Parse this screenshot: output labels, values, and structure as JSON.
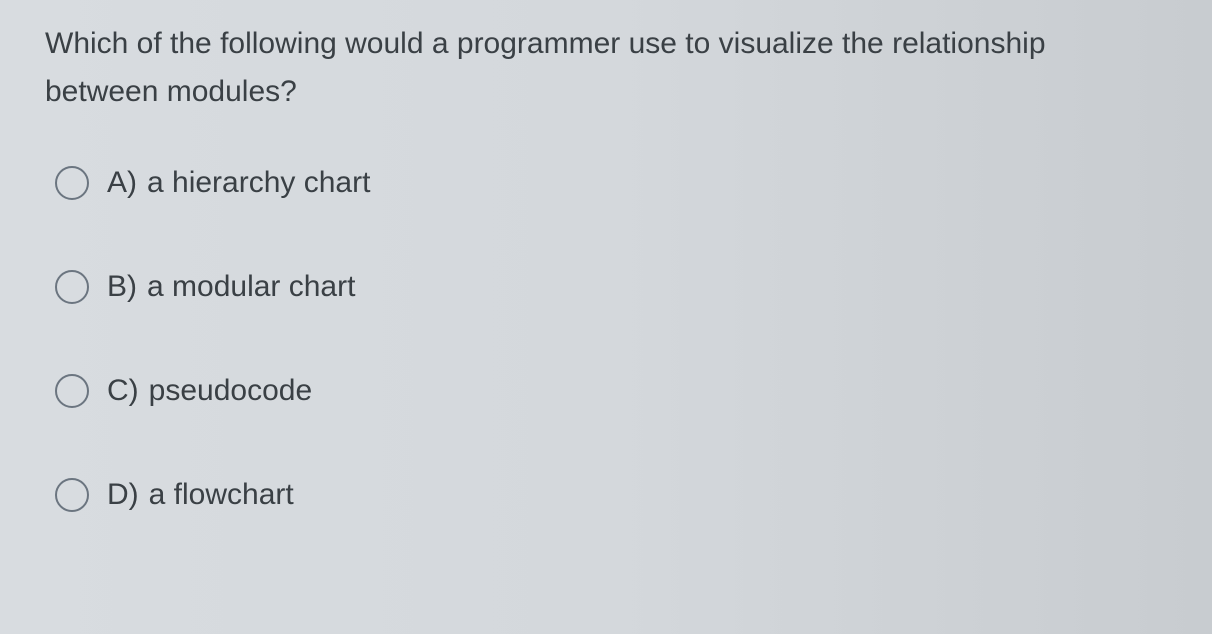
{
  "question": {
    "text": "Which of the following would a programmer use to visualize the relationship between modules?"
  },
  "options": [
    {
      "letter": "A)",
      "text": "a hierarchy chart"
    },
    {
      "letter": "B)",
      "text": "a modular chart"
    },
    {
      "letter": "C)",
      "text": "pseudocode"
    },
    {
      "letter": "D)",
      "text": "a flowchart"
    }
  ]
}
